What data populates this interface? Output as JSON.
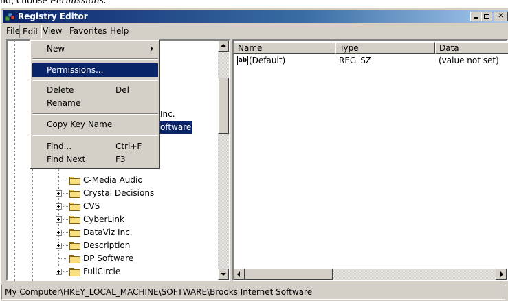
{
  "caption": {
    "prefix": "nd, choose ",
    "emphasis": "Permissions."
  },
  "window": {
    "title": "Registry Editor"
  },
  "menubar": [
    "File",
    "Edit",
    "View",
    "Favorites",
    "Help"
  ],
  "edit_menu": {
    "items": [
      {
        "label": "New",
        "shortcut": "",
        "submenu": true
      },
      {
        "label": "Permissions...",
        "shortcut": "",
        "selected": true
      },
      {
        "label": "Delete",
        "shortcut": "Del"
      },
      {
        "label": "Rename",
        "shortcut": ""
      },
      {
        "label": "Copy Key Name",
        "shortcut": ""
      },
      {
        "label": "Find...",
        "shortcut": "Ctrl+F"
      },
      {
        "label": "Find Next",
        "shortcut": "F3"
      }
    ]
  },
  "tree": {
    "partial_visible": [
      "Inc.",
      "oftware"
    ],
    "items": [
      {
        "label": "C-Media Audio",
        "expandable": false
      },
      {
        "label": "Crystal Decisions",
        "expandable": true
      },
      {
        "label": "CVS",
        "expandable": true
      },
      {
        "label": "CyberLink",
        "expandable": true
      },
      {
        "label": "DataViz Inc.",
        "expandable": true
      },
      {
        "label": "Description",
        "expandable": true
      },
      {
        "label": "DP Software",
        "expandable": false
      },
      {
        "label": "FullCircle",
        "expandable": true
      }
    ]
  },
  "list": {
    "columns": [
      "Name",
      "Type",
      "Data"
    ],
    "rows": [
      {
        "icon": "string-value-icon",
        "icon_text": "ab",
        "name": "(Default)",
        "type": "REG_SZ",
        "data": "(value not set)"
      }
    ]
  },
  "statusbar": {
    "path": "My Computer\\HKEY_LOCAL_MACHINE\\SOFTWARE\\Brooks Internet Software"
  },
  "colors": {
    "title_active": "#0a246a",
    "selection": "#0a246a",
    "face": "#d4d0c8"
  }
}
